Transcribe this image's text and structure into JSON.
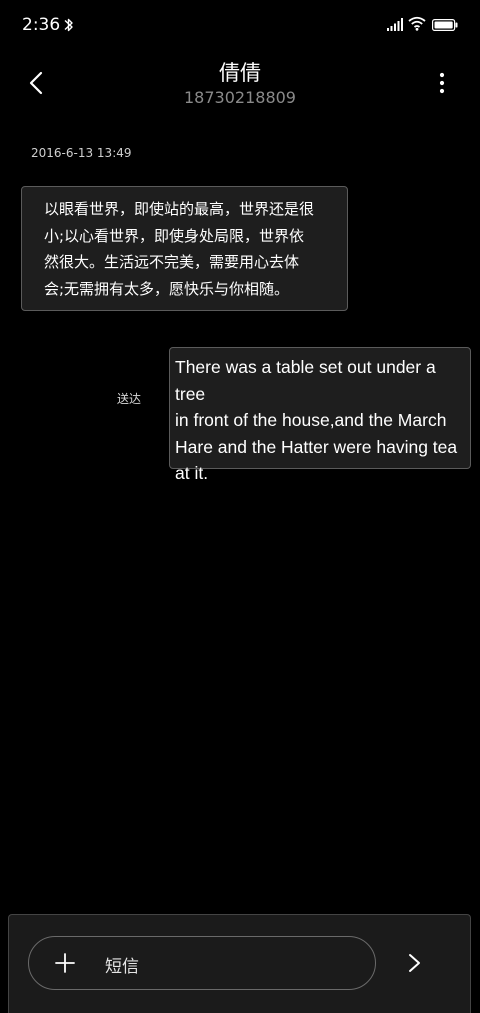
{
  "status_bar": {
    "time": "2:36",
    "icons": [
      "bluetooth-icon",
      "signal-icon",
      "wifi-icon",
      "battery-icon"
    ]
  },
  "header": {
    "contact_name": "倩倩",
    "contact_number": "18730218809",
    "icons": [
      "back-arrow-icon",
      "more-vertical-icon"
    ]
  },
  "conversation": {
    "timestamp": "2016-6-13 13:49",
    "incoming_message": {
      "lines": [
        "以眼看世界，即使站的最高，世界还是很",
        "小;以心看世界，即使身处局限，世界依",
        "然很大。生活远不完美，需要用心去体",
        "会;无需拥有太多，愿快乐与你相随。"
      ]
    },
    "outgoing_message": {
      "lines": [
        "There was a table set out under a tree",
        "in front of the house,and the March",
        "Hare and the Hatter were having tea",
        "at it."
      ],
      "status": "送达"
    }
  },
  "composer": {
    "placeholder": "短信",
    "icons": [
      "plus-icon",
      "send-arrow-icon"
    ]
  },
  "colors": {
    "background": "#000000",
    "bubble_background": "#1e1e1e",
    "bubble_border": "#5b5b5b",
    "secondary_text": "#8a8a8a"
  }
}
